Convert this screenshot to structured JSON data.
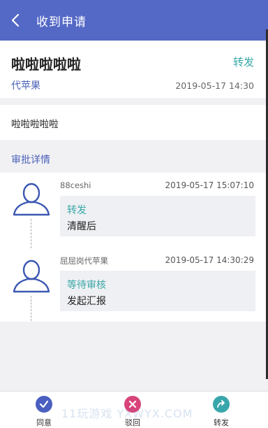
{
  "header": {
    "title": "收到申请",
    "back_icon": "chevron-left-icon"
  },
  "summary": {
    "title": "啦啦啦啦啦",
    "forward_label": "转发",
    "applicant": "代苹果",
    "time": "2019-05-17 14:30"
  },
  "content": {
    "text": "啦啦啦啦啦"
  },
  "approval": {
    "section_title": "审批详情",
    "entries": [
      {
        "name": "88ceshi",
        "time": "2019-05-17 15:07:10",
        "action": "转发",
        "note": "清醒后",
        "icon": "user-icon"
      },
      {
        "name": "屈屈岗代苹果",
        "time": "2019-05-17 14:30:29",
        "action": "等待审核",
        "note": "发起汇报",
        "icon": "user-icon"
      }
    ]
  },
  "actions": {
    "approve": {
      "label": "同意",
      "color": "#4b5fc0",
      "icon": "check-icon"
    },
    "reject": {
      "label": "驳回",
      "color": "#d8437a",
      "icon": "close-icon"
    },
    "forward": {
      "label": "转发",
      "color": "#38a7ab",
      "icon": "forward-icon"
    }
  },
  "watermark": "11玩游戏 YXWYX.COM",
  "colors": {
    "header": "#5468c6",
    "accent_teal": "#3aa7a8",
    "accent_blue": "#4b61b8"
  }
}
